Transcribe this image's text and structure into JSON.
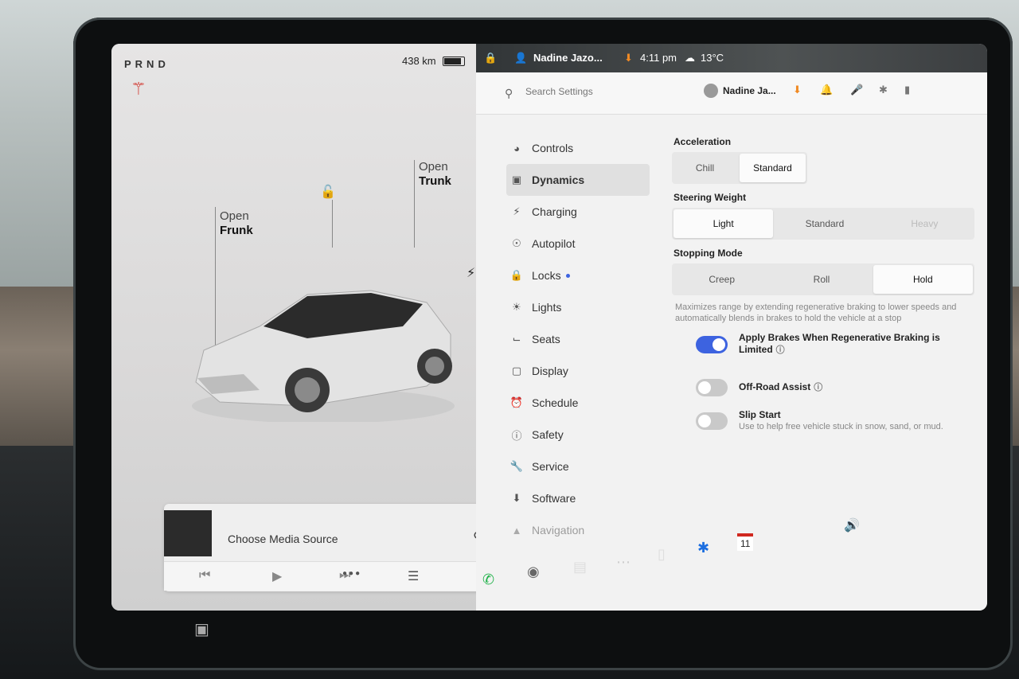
{
  "left": {
    "gear": "PRND",
    "range": "438 km",
    "frunk_open": "Open",
    "frunk_label": "Frunk",
    "trunk_open": "Open",
    "trunk_label": "Trunk"
  },
  "media": {
    "title": "Choose Media Source"
  },
  "status": {
    "profile": "Nadine Jazo...",
    "time": "4:11 pm",
    "temp": "13°C"
  },
  "settings": {
    "search_placeholder": "Search Settings",
    "profile_name": "Nadine Ja...",
    "menu": [
      {
        "label": "Controls",
        "icon": "toggle-icon"
      },
      {
        "label": "Dynamics",
        "icon": "car-icon",
        "active": true
      },
      {
        "label": "Charging",
        "icon": "bolt-icon"
      },
      {
        "label": "Autopilot",
        "icon": "steering-wheel-icon"
      },
      {
        "label": "Locks",
        "icon": "lock-icon",
        "badge": true
      },
      {
        "label": "Lights",
        "icon": "sun-icon"
      },
      {
        "label": "Seats",
        "icon": "seat-icon"
      },
      {
        "label": "Display",
        "icon": "display-icon"
      },
      {
        "label": "Schedule",
        "icon": "alarm-clock-icon"
      },
      {
        "label": "Safety",
        "icon": "warning-icon"
      },
      {
        "label": "Service",
        "icon": "wrench-icon"
      },
      {
        "label": "Software",
        "icon": "download-icon"
      },
      {
        "label": "Navigation",
        "icon": "navigation-icon"
      }
    ],
    "acceleration": {
      "title": "Acceleration",
      "options": [
        "Chill",
        "Standard"
      ],
      "selected": "Standard"
    },
    "steering": {
      "title": "Steering Weight",
      "options": [
        "Light",
        "Standard",
        "Heavy"
      ],
      "selected": "Light"
    },
    "stopping": {
      "title": "Stopping Mode",
      "options": [
        "Creep",
        "Roll",
        "Hold"
      ],
      "selected": "Hold",
      "description": "Maximizes range by extending regenerative braking to lower speeds and automatically blends in brakes to hold the vehicle at a stop"
    },
    "toggles": [
      {
        "label": "Apply Brakes When Regenerative Braking is Limited",
        "on": true
      },
      {
        "label": "Off-Road Assist",
        "on": false
      },
      {
        "label": "Slip Start",
        "sub": "Use to help free vehicle stuck in snow, sand, or mud.",
        "on": false
      }
    ]
  },
  "dock": {
    "calendar_day": "11"
  },
  "colors": {
    "accent": "#3d63e0",
    "seatbelt_warning": "#d0281f",
    "phone": "#21b24a",
    "bluetooth": "#1d6fe0"
  }
}
